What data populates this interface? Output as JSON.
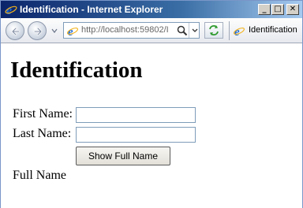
{
  "window": {
    "title": "Identification - Internet Explorer",
    "controls": {
      "minimize": "_",
      "maximize": "□",
      "close": "✕"
    }
  },
  "toolbar": {
    "url": "http://localhost:59802/I",
    "tab_label": "Identification"
  },
  "page": {
    "heading": "Identification",
    "first_name_label": "First Name:",
    "first_name_value": "",
    "last_name_label": "Last Name:",
    "last_name_value": "",
    "button_label": "Show Full Name",
    "result_text": "Full Name"
  },
  "colors": {
    "title_gradient_start": "#0a246a",
    "title_gradient_end": "#a6caf0",
    "ie_blue": "#1e6bd6",
    "ie_ring": "#f2b21a"
  },
  "icons": {
    "app": "internet-explorer-icon",
    "back": "back-arrow-icon",
    "forward": "forward-arrow-icon",
    "history": "chevron-down-icon",
    "page": "internet-explorer-page-icon",
    "search": "search-icon",
    "address_dropdown": "chevron-down-icon",
    "compat": "refresh-arrows-icon"
  }
}
